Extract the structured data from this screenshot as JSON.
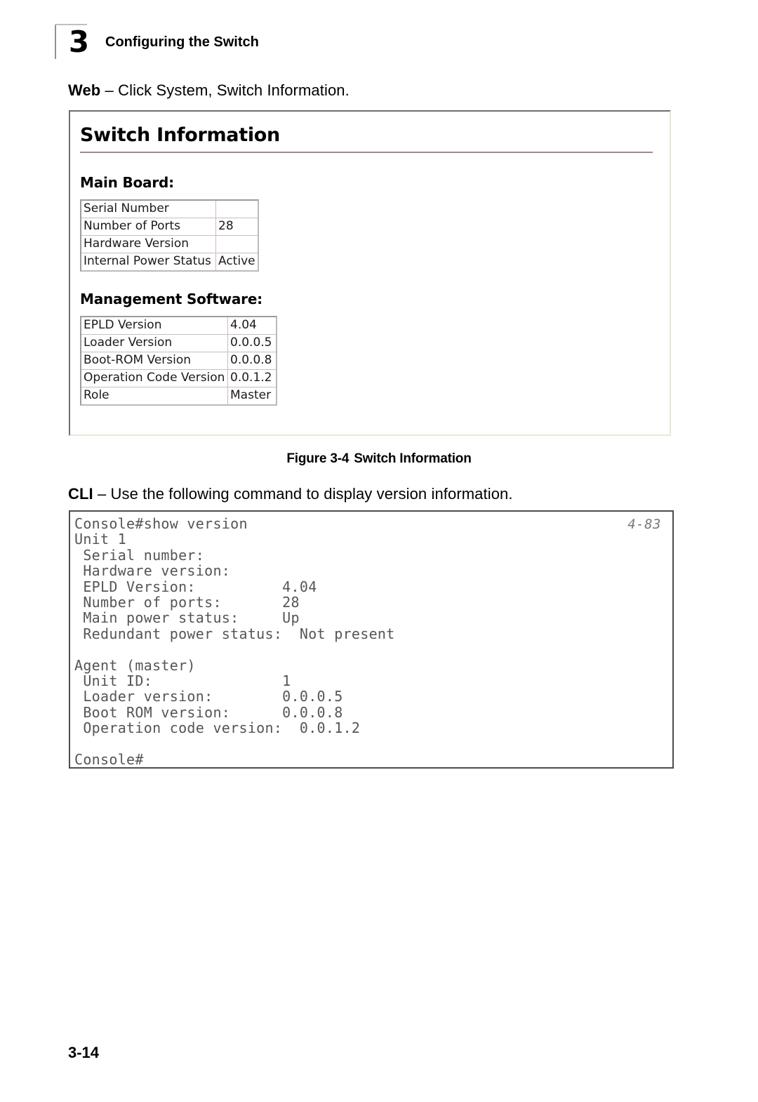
{
  "running_head": {
    "chapter_number": "3",
    "title": "Configuring the Switch"
  },
  "web_instruction": {
    "label": "Web",
    "dash": " – ",
    "text": "Click System, Switch Information."
  },
  "cli_instruction": {
    "label": "CLI",
    "dash": " – ",
    "text": "Use the following command to display version information."
  },
  "screenshot_panel": {
    "title": "Switch Information",
    "main_board": {
      "label": "Main Board:",
      "rows": [
        {
          "key": "Serial Number",
          "value": ""
        },
        {
          "key": "Number of Ports",
          "value": "28"
        },
        {
          "key": "Hardware Version",
          "value": ""
        },
        {
          "key": "Internal Power Status",
          "value": "Active"
        }
      ]
    },
    "management_software": {
      "label": "Management Software:",
      "rows": [
        {
          "key": "EPLD Version",
          "value": "4.04"
        },
        {
          "key": "Loader Version",
          "value": "0.0.0.5"
        },
        {
          "key": "Boot-ROM Version",
          "value": "0.0.0.8"
        },
        {
          "key": "Operation Code Version",
          "value": "0.0.1.2"
        },
        {
          "key": "Role",
          "value": "Master"
        }
      ]
    }
  },
  "figure_caption": {
    "number": "Figure 3-4",
    "title": "Switch Information"
  },
  "console": {
    "page_reference": "4-83",
    "text": "Console#show version\nUnit 1\n Serial number:\n Hardware version:\n EPLD Version:          4.04\n Number of ports:       28\n Main power status:     Up\n Redundant power status:  Not present\n\nAgent (master)\n Unit ID:               1\n Loader version:        0.0.0.5\n Boot ROM version:      0.0.0.8\n Operation code version:  0.0.1.2\n\nConsole#"
  },
  "footer": {
    "page_number": "3-14"
  },
  "colors": {
    "heading_rule": "#a08c8c",
    "chapter_rule": "#9b8d8d",
    "table_border_outer": "#9c9c9c",
    "table_border_inner": "#cbbdbd",
    "console_border": "#4d4d4d",
    "console_text": "#555555",
    "panel_border_dark": "#6e6e6e",
    "panel_border_light": "#e8e7d8"
  }
}
